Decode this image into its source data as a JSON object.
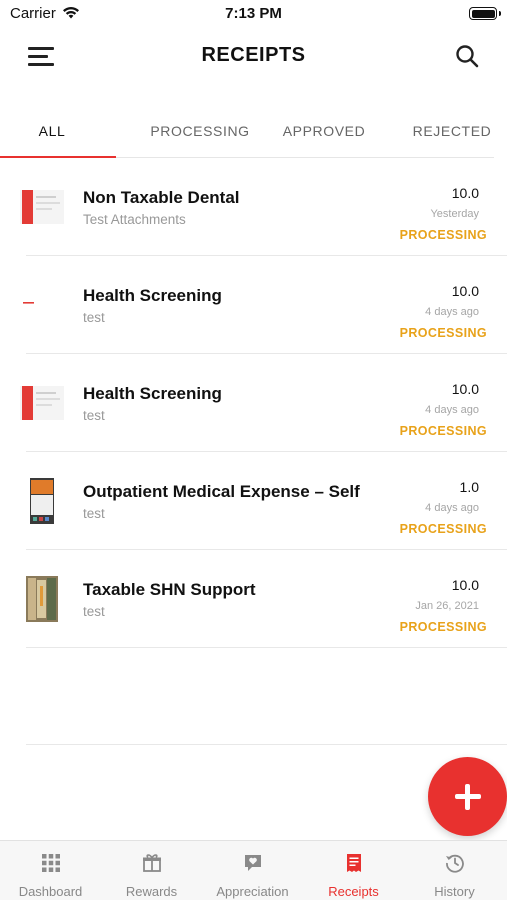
{
  "status_bar": {
    "carrier": "Carrier",
    "time": "7:13 PM"
  },
  "header": {
    "title": "RECEIPTS"
  },
  "tabs": [
    {
      "label": "ALL",
      "active": true
    },
    {
      "label": "PROCESSING",
      "active": false
    },
    {
      "label": "APPROVED",
      "active": false
    },
    {
      "label": "REJECTED",
      "active": false
    }
  ],
  "receipts": [
    {
      "title": "Non Taxable Dental",
      "subtitle": "Test Attachments",
      "amount": "10.0",
      "date": "Yesterday",
      "status": "PROCESSING"
    },
    {
      "title": "Health Screening",
      "subtitle": "test",
      "amount": "10.0",
      "date": "4 days ago",
      "status": "PROCESSING"
    },
    {
      "title": "Health Screening",
      "subtitle": "test",
      "amount": "10.0",
      "date": "4 days ago",
      "status": "PROCESSING"
    },
    {
      "title": "Outpatient Medical Expense – Self",
      "subtitle": "test",
      "amount": "1.0",
      "date": "4 days ago",
      "status": "PROCESSING"
    },
    {
      "title": "Taxable SHN Support",
      "subtitle": "test",
      "amount": "10.0",
      "date": "Jan 26, 2021",
      "status": "PROCESSING"
    }
  ],
  "bottom_nav": [
    {
      "label": "Dashboard",
      "icon": "grid-icon",
      "active": false
    },
    {
      "label": "Rewards",
      "icon": "gift-icon",
      "active": false
    },
    {
      "label": "Appreciation",
      "icon": "heart-chat-icon",
      "active": false
    },
    {
      "label": "Receipts",
      "icon": "receipt-icon",
      "active": true
    },
    {
      "label": "History",
      "icon": "history-icon",
      "active": false
    }
  ],
  "colors": {
    "accent": "#e8312f",
    "status_processing": "#e8a21a",
    "muted_text": "#999999"
  }
}
